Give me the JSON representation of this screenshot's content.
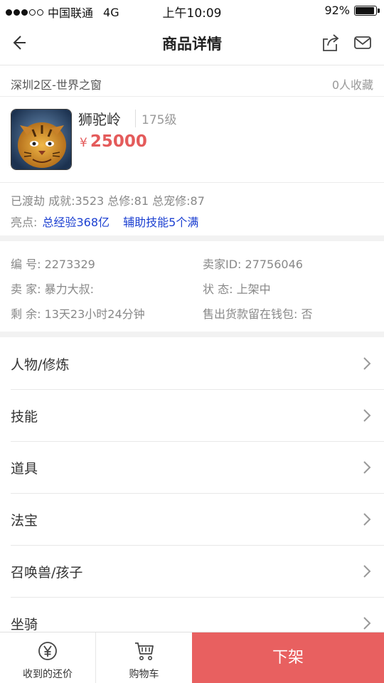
{
  "status_bar": {
    "carrier": "中国联通",
    "network": "4G",
    "time": "上午10:09",
    "battery_percent": "92%",
    "battery_level": 0.92,
    "signal_bars_filled": 3,
    "signal_bars_total": 5
  },
  "nav": {
    "title": "商品详情",
    "back_icon": "back-arrow-icon",
    "share_icon": "share-icon",
    "mail_icon": "mail-icon"
  },
  "server": {
    "name": "深圳2区-世界之窗",
    "favorites": "0人收藏"
  },
  "product": {
    "name": "狮驼岭",
    "level": "175级",
    "price_symbol": "¥",
    "price": "25000"
  },
  "stats": {
    "line": "已渡劫 成就:3523 总修:81 总宠修:87",
    "highlights_label": "亮点:",
    "highlights": [
      "总经验368亿",
      "辅助技能5个满"
    ]
  },
  "info": {
    "serial": "编  号: 2273329",
    "seller_id": "卖家ID: 27756046",
    "seller": "卖  家: 暴力大叔:",
    "status": "状  态: 上架中",
    "remaining": "剩  余: 13天23小时24分钟",
    "wallet": "售出货款留在钱包: 否"
  },
  "menu": [
    {
      "label": "人物/修炼"
    },
    {
      "label": "技能"
    },
    {
      "label": "道具"
    },
    {
      "label": "法宝"
    },
    {
      "label": "召唤兽/孩子"
    },
    {
      "label": "坐骑"
    }
  ],
  "bottom_bar": {
    "offers_label": "收到的还价",
    "cart_label": "购物车",
    "delist_label": "下架",
    "offers_icon": "yen-coin-icon",
    "cart_icon": "shopping-cart-icon"
  },
  "colors": {
    "price": "#e45b5b",
    "highlight": "#1b3fd1",
    "delist_button": "#e86060"
  }
}
